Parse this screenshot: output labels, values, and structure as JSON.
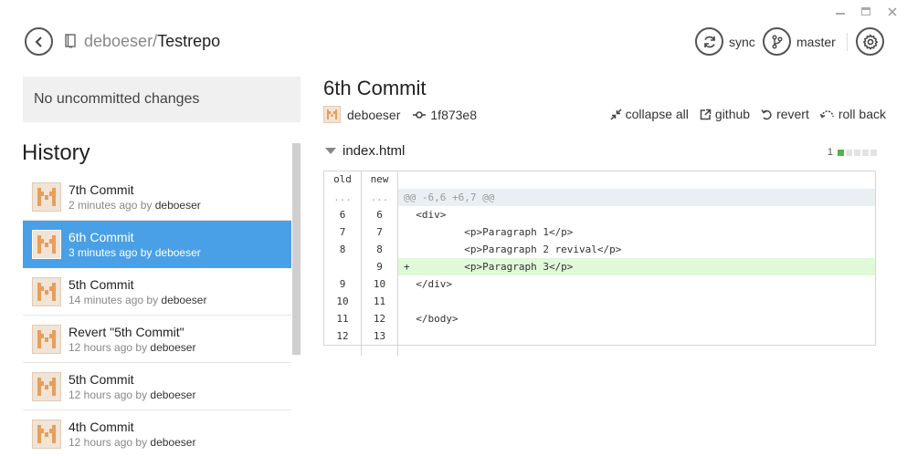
{
  "window": {
    "min_icon": "minimize-icon",
    "max_icon": "maximize-icon",
    "close_icon": "close-icon"
  },
  "header": {
    "back_icon": "chevron-left-icon",
    "repo_icon": "repo-book-icon",
    "owner": "deboeser",
    "separator": "/",
    "repo": "Testrepo",
    "sync_label": "sync",
    "sync_icon": "sync-icon",
    "branch_label": "master",
    "branch_icon": "branch-icon",
    "settings_icon": "gear-icon"
  },
  "sidebar": {
    "uncommitted_text": "No uncommitted changes",
    "history_title": "History",
    "commits": [
      {
        "title": "7th Commit",
        "time": "2 minutes ago by",
        "author": "deboeser",
        "selected": false
      },
      {
        "title": "6th Commit",
        "time": "3 minutes ago by",
        "author": "deboeser",
        "selected": true
      },
      {
        "title": "5th Commit",
        "time": "14 minutes ago by",
        "author": "deboeser",
        "selected": false
      },
      {
        "title": "Revert \"5th Commit\"",
        "time": "12 hours ago by",
        "author": "deboeser",
        "selected": false
      },
      {
        "title": "5th Commit",
        "time": "12 hours ago by",
        "author": "deboeser",
        "selected": false
      },
      {
        "title": "4th Commit",
        "time": "12 hours ago by",
        "author": "deboeser",
        "selected": false
      }
    ]
  },
  "commit": {
    "title": "6th Commit",
    "author": "deboeser",
    "sha": "1f873e8",
    "actions": {
      "collapse_all": "collapse all",
      "github": "github",
      "revert": "revert",
      "roll_back": "roll back"
    }
  },
  "file": {
    "name": "index.html",
    "additions": "1",
    "stat_blocks": [
      1,
      0,
      0,
      0,
      0
    ],
    "colors": {
      "added_bg": "#dff9d9",
      "hunk_bg": "#eaeff3",
      "selected": "#4aa0e6"
    },
    "col_old": "old",
    "col_new": "new",
    "lines": [
      {
        "old": "...",
        "new": "...",
        "code": "@@ -6,6 +6,7 @@",
        "type": "hunk"
      },
      {
        "old": "6",
        "new": "6",
        "code": "  <div>",
        "type": "ctx"
      },
      {
        "old": "7",
        "new": "7",
        "code": "          <p>Paragraph 1</p>",
        "type": "ctx"
      },
      {
        "old": "8",
        "new": "8",
        "code": "          <p>Paragraph 2 revival</p>",
        "type": "ctx"
      },
      {
        "old": "",
        "new": "9",
        "code": "+         <p>Paragraph 3</p>",
        "type": "added"
      },
      {
        "old": "9",
        "new": "10",
        "code": "  </div>",
        "type": "ctx"
      },
      {
        "old": "10",
        "new": "11",
        "code": "",
        "type": "ctx"
      },
      {
        "old": "11",
        "new": "12",
        "code": "  </body>",
        "type": "ctx"
      },
      {
        "old": "12",
        "new": "13",
        "code": "",
        "type": "ctx"
      }
    ]
  }
}
